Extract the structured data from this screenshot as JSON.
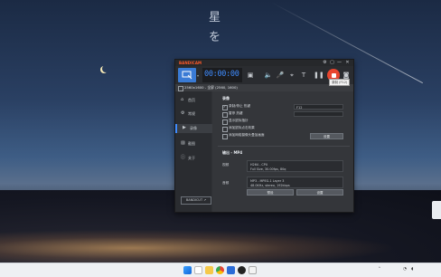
{
  "desktop": {
    "deco_char_1": "星",
    "deco_char_2": "を"
  },
  "app": {
    "logo": "BANDICAM",
    "title_text": "",
    "vip_label": "",
    "window_buttons": [
      "⚙",
      "▢",
      "—",
      "✕"
    ],
    "timer": "00:00:00",
    "size_text": "",
    "recording_tooltip": "录制 (F12)",
    "target_text": "2560x1600 - 全屏 (2560, 1600)",
    "sidebar": {
      "items": [
        {
          "label": "首页",
          "icon": "home-icon"
        },
        {
          "label": "常规",
          "icon": "gear-icon"
        },
        {
          "label": "录像",
          "icon": "video-icon"
        },
        {
          "label": "截图",
          "icon": "image-icon"
        },
        {
          "label": "关于",
          "icon": "info-icon"
        }
      ],
      "bottom_label": "BANDICUT ↗"
    },
    "settings": {
      "record_section": "录像",
      "options": [
        {
          "label": "录制/停止 热键",
          "checked": true
        },
        {
          "label": "暂停 热键",
          "checked": false
        },
        {
          "label": "显示鼠标指针",
          "checked": false
        },
        {
          "label": "添加鼠标点击效果",
          "checked": false
        },
        {
          "label": "添加网络摄像头叠加画面",
          "checked": false
        }
      ],
      "hotkey_1": "F12",
      "hotkey_2": "",
      "settings_button": "设置",
      "output_section": "输出 - MP4",
      "video_label": "视频",
      "video_line_1": "H264 - CPU",
      "video_line_2": "Full Size, 30.00fps, 80q",
      "audio_label": "音频",
      "audio_line_1": "MP3 - MPEG-1 Layer 3",
      "audio_line_2": "48.0KHz, stereo, 192kbps",
      "preset_button": "预设",
      "output_settings_button": "设置"
    }
  },
  "taskbar": {
    "tray_time": "",
    "tray_lang": ""
  },
  "colors": {
    "accent_blue": "#3f8cff",
    "record_red": "#e8452e",
    "logo_orange": "#ff5a2a"
  }
}
